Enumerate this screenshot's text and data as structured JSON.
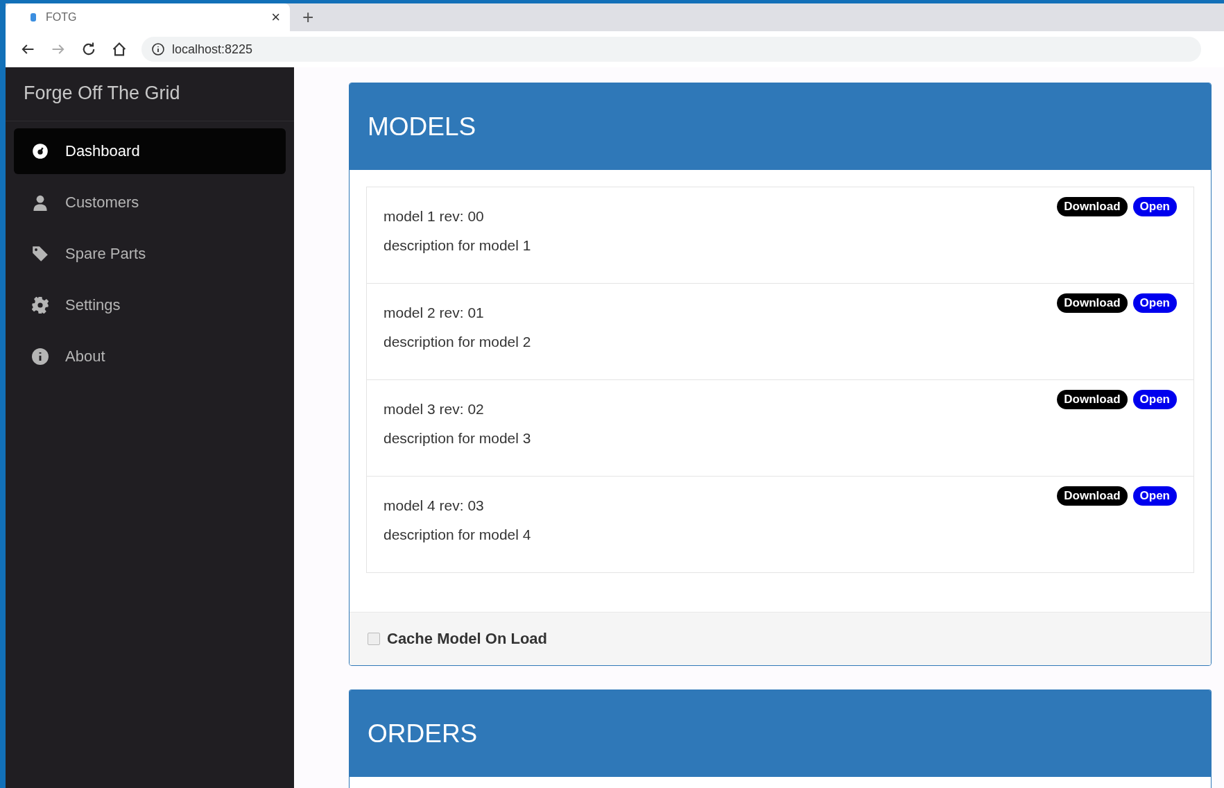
{
  "browser": {
    "tab_title": "FOTG",
    "tab_close": "×",
    "new_tab": "+",
    "address": "localhost:8225"
  },
  "app": {
    "brand": "Forge Off The Grid"
  },
  "sidebar": {
    "items": [
      {
        "label": "Dashboard",
        "selected": true
      },
      {
        "label": "Customers",
        "selected": false
      },
      {
        "label": "Spare Parts",
        "selected": false
      },
      {
        "label": "Settings",
        "selected": false
      },
      {
        "label": "About",
        "selected": false
      }
    ]
  },
  "models_panel": {
    "title": "MODELS",
    "models": [
      {
        "name": "model 1 rev: 00",
        "description": "description for model 1",
        "download": "Download",
        "open": "Open"
      },
      {
        "name": "model 2 rev: 01",
        "description": "description for model 2",
        "download": "Download",
        "open": "Open"
      },
      {
        "name": "model 3 rev: 02",
        "description": "description for model 3",
        "download": "Download",
        "open": "Open"
      },
      {
        "name": "model 4 rev: 03",
        "description": "description for model 4",
        "download": "Download",
        "open": "Open"
      }
    ],
    "cache_option": {
      "label": "Cache Model On Load",
      "checked": false
    }
  },
  "orders_panel": {
    "title": "ORDERS"
  }
}
